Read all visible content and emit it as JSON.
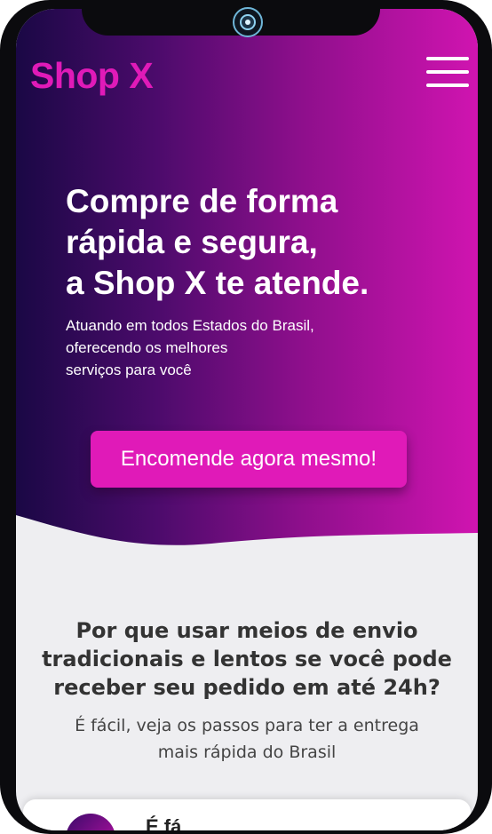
{
  "header": {
    "logo": "Shop X",
    "menu_icon": "hamburger-menu-icon"
  },
  "hero": {
    "headline_lines": [
      "Compre de forma",
      "rápida e segura,",
      "a Shop X te atende."
    ],
    "subtext_lines": [
      "Atuando em todos Estados do Brasil,",
      "oferecendo os melhores",
      "serviços para você"
    ],
    "cta_label": "Encomende agora mesmo!"
  },
  "section": {
    "title_lines": [
      "Por que usar meios de envio",
      "tradicionais e lentos se você pode",
      "receber seu pedido em até 24h?"
    ],
    "subtitle_lines": [
      "É fácil, veja os passos para ter a entrega",
      "mais rápida do Brasil"
    ]
  },
  "card": {
    "title": "É fá",
    "icon": "step-icon"
  },
  "colors": {
    "brand": "#e01ab8",
    "hero_gradient_start": "#1a0845",
    "hero_gradient_end": "#d014b0",
    "background": "#eeeef1"
  }
}
